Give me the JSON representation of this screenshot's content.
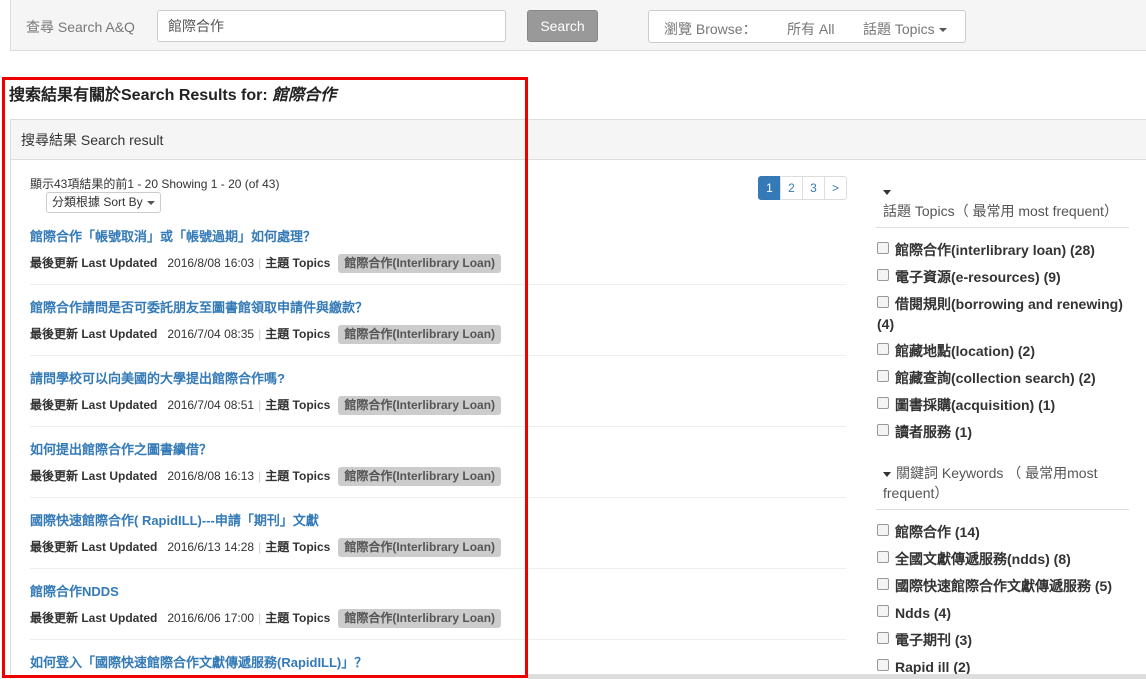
{
  "search": {
    "label": "查尋 Search A&Q",
    "value": "館際合作",
    "button": "Search"
  },
  "browse": {
    "label": "瀏覽 Browse：",
    "all": "所有 All",
    "topics": "話題 Topics"
  },
  "results_heading": {
    "prefix": "搜索結果有關於Search Results for: ",
    "query": "館際合作"
  },
  "panel_title": "搜尋結果 Search result",
  "count_text": "顯示43項結果的前1 - 20 Showing 1 - 20 (of 43)",
  "sort_label": "分類根據 Sort By",
  "pagination": [
    "1",
    "2",
    "3",
    ">"
  ],
  "meta_labels": {
    "updated": "最後更新 Last Updated",
    "topics": "主題 Topics"
  },
  "results": [
    {
      "title": "館際合作「帳號取消」或「帳號過期」如何處理？",
      "date": "2016/8/08 16:03",
      "tag": "館際合作(Interlibrary Loan)"
    },
    {
      "title": "館際合作請問是否可委託朋友至圖書館領取申請件與繳款？",
      "date": "2016/7/04 08:35",
      "tag": "館際合作(Interlibrary Loan)"
    },
    {
      "title": "請問學校可以向美國的大學提出館際合作嗎?",
      "date": "2016/7/04 08:51",
      "tag": "館際合作(Interlibrary Loan)"
    },
    {
      "title": "如何提出館際合作之圖書續借？",
      "date": "2016/8/08 16:13",
      "tag": "館際合作(Interlibrary Loan)"
    },
    {
      "title": "國際快速館際合作( RapidILL)---申請「期刊」文獻",
      "date": "2016/6/13 14:28",
      "tag": "館際合作(Interlibrary Loan)"
    },
    {
      "title": "館際合作NDDS",
      "date": "2016/6/06 17:00",
      "tag": "館際合作(Interlibrary Loan)"
    },
    {
      "title": "如何登入「國際快速館際合作文獻傳遞服務(RapidILL)」？",
      "date": "",
      "tag": ""
    }
  ],
  "topics_facet": {
    "heading": "話題 Topics（ 最常用 most frequent）",
    "items": [
      "館際合作(interlibrary loan) (28)",
      "電子資源(e-resources) (9)",
      "借閱規則(borrowing and renewing) (4)",
      "館藏地點(location) (2)",
      "館藏查詢(collection search) (2)",
      "圖書採購(acquisition) (1)",
      "讀者服務 (1)"
    ]
  },
  "keywords_facet": {
    "heading": "關鍵詞 Keywords （ 最常用most frequent）",
    "items": [
      "館際合作 (14)",
      "全國文獻傳遞服務(ndds) (8)",
      "國際快速館際合作文獻傳遞服務 (5)",
      "Ndds (4)",
      "電子期刊 (3)",
      "Rapid ill (2)"
    ]
  },
  "colors": {
    "link": "#337ab7",
    "highlight_border": "#e00000",
    "tag_bg": "#cccccc"
  }
}
